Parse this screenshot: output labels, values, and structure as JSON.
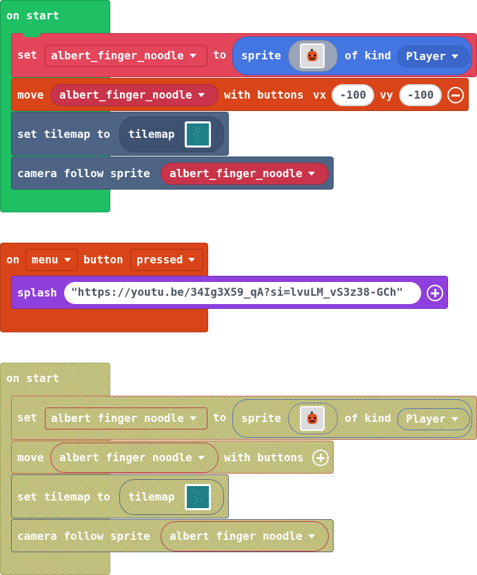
{
  "colors": {
    "loops_green": "#1fbf63",
    "sprites_red": "#e3455a",
    "controller_orange": "#d94418",
    "scene_slate": "#4d6485",
    "sprite_kind_blue": "#4476e2",
    "game_purple": "#8f3fdc",
    "ghost_fill": "#c9c979"
  },
  "block1": {
    "hat_label": "on start",
    "set": {
      "prefix": "set",
      "variable": "albert_finger_noodle",
      "to": "to",
      "sprite_label": "sprite",
      "of_kind": "of kind",
      "kind": "Player",
      "sprite_icon": "pumpkin-sprite-icon"
    },
    "move": {
      "prefix": "move",
      "variable": "albert_finger_noodle",
      "with_buttons": "with buttons",
      "vx_label": "vx",
      "vx": "-100",
      "vy_label": "vy",
      "vy": "-100"
    },
    "tilemap": {
      "prefix": "set tilemap to",
      "tilemap_label": "tilemap",
      "tilemap_icon": "tilemap-thumbnail-icon"
    },
    "camera": {
      "prefix": "camera follow sprite",
      "variable": "albert_finger_noodle"
    }
  },
  "block2": {
    "on": "on",
    "button": "menu",
    "button_word": "button",
    "event": "pressed",
    "splash": {
      "prefix": "splash",
      "text": "\"https://youtu.be/34Ig3X59_qA?si=lvuLM_vS3z38-GCh\""
    }
  },
  "block3": {
    "hat_label": "on start",
    "set": {
      "prefix": "set",
      "variable": "albert finger noodle",
      "to": "to",
      "sprite_label": "sprite",
      "of_kind": "of kind",
      "kind": "Player"
    },
    "move": {
      "prefix": "move",
      "variable": "albert finger noodle",
      "with_buttons": "with buttons"
    },
    "tilemap": {
      "prefix": "set tilemap to",
      "tilemap_label": "tilemap"
    },
    "camera": {
      "prefix": "camera follow sprite",
      "variable": "albert finger noodle"
    }
  }
}
